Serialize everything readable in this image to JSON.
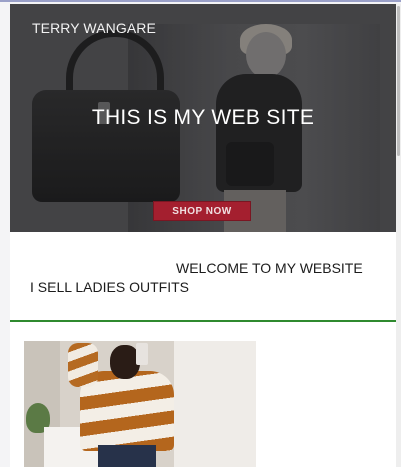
{
  "hero": {
    "brand": "TERRY WANGARE",
    "title": "THIS  IS MY WEB SITE",
    "shop_button": "SHOP NOW"
  },
  "welcome": {
    "heading": "WELCOME TO MY WEBSITE",
    "subheading": "I SELL LADIES OUTFITS"
  },
  "colors": {
    "divider": "#2f8a2f",
    "shop_button": "#a41f2f",
    "hero_overlay": "#4e4e50"
  }
}
